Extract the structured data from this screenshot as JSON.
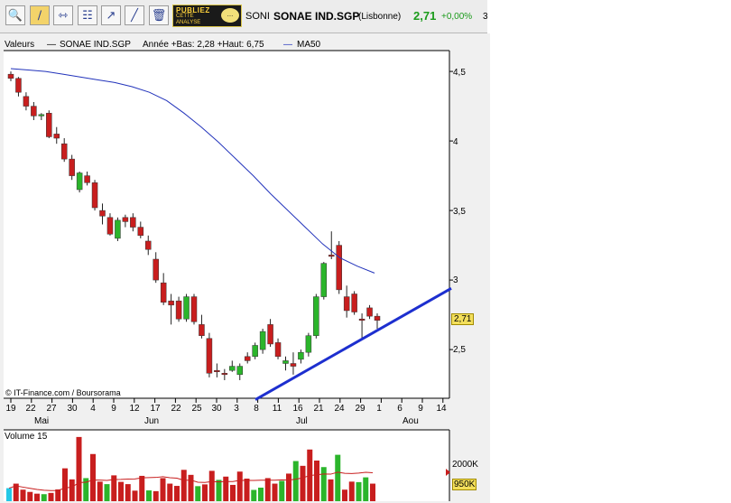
{
  "toolbar": {
    "buttons": [
      "zoom-icon",
      "draw-line-icon",
      "horizontal-line-icon",
      "indicators-icon",
      "fibonacci-icon",
      "trend-tool-icon",
      "trash-icon"
    ],
    "publiez_line1": "PUBLIEZ",
    "publiez_line2": "CETTE",
    "publiez_line3": "ANALYSE",
    "ticker_short": "SONI",
    "ticker": "SONAE IND.SGP",
    "market": "(Lisbonne)",
    "price": "2,71",
    "change": "+0,00%",
    "cut_digit": "3"
  },
  "legend": {
    "valeurs": "Valeurs",
    "series": "SONAE IND.SGP",
    "range": "Année +Bas: 2,28 +Haut: 6,75",
    "ma": "MA50"
  },
  "credit": "© IT-Finance.com / Boursorama",
  "volume_label": "Volume 15",
  "price_label": "2,71",
  "colors": {
    "up": "#2bb52b",
    "down": "#c81e1e",
    "ma": "#2233bb",
    "trend": "#1d2fcf",
    "volume_cyan": "#22c8e6",
    "price_tag": "#f3df5b"
  },
  "chart_data": [
    {
      "type": "candlestick",
      "title": "SONAE IND.SGP",
      "y_ticks": [
        "4,5",
        "4",
        "3,5",
        "3",
        "2,5"
      ],
      "y_tick_values": [
        4.5,
        4.0,
        3.5,
        3.0,
        2.5
      ],
      "ylim": [
        2.15,
        4.65
      ],
      "x_tick_labels": [
        "19",
        "22",
        "27",
        "30",
        "4",
        "9",
        "12",
        "17",
        "22",
        "25",
        "30",
        "3",
        "8",
        "11",
        "16",
        "21",
        "24",
        "29",
        "1",
        "6",
        "9",
        "14"
      ],
      "month_labels": [
        "Mai",
        "Jun",
        "Jul",
        "Aou"
      ],
      "candles": [
        [
          4.48,
          4.5,
          4.43,
          4.45
        ],
        [
          4.45,
          4.46,
          4.32,
          4.35
        ],
        [
          4.32,
          4.35,
          4.22,
          4.25
        ],
        [
          4.25,
          4.28,
          4.15,
          4.18
        ],
        [
          4.18,
          4.2,
          4.15,
          4.19
        ],
        [
          4.2,
          4.22,
          4.02,
          4.03
        ],
        [
          4.05,
          4.1,
          3.98,
          4.02
        ],
        [
          3.98,
          4.02,
          3.85,
          3.87
        ],
        [
          3.87,
          3.9,
          3.72,
          3.75
        ],
        [
          3.65,
          3.78,
          3.63,
          3.77
        ],
        [
          3.75,
          3.78,
          3.68,
          3.7
        ],
        [
          3.7,
          3.72,
          3.5,
          3.52
        ],
        [
          3.5,
          3.55,
          3.4,
          3.46
        ],
        [
          3.45,
          3.48,
          3.32,
          3.33
        ],
        [
          3.3,
          3.45,
          3.28,
          3.43
        ],
        [
          3.45,
          3.47,
          3.38,
          3.42
        ],
        [
          3.45,
          3.48,
          3.35,
          3.38
        ],
        [
          3.38,
          3.42,
          3.3,
          3.32
        ],
        [
          3.28,
          3.32,
          3.18,
          3.22
        ],
        [
          3.15,
          3.2,
          2.98,
          3.0
        ],
        [
          2.98,
          3.05,
          2.82,
          2.84
        ],
        [
          2.85,
          2.9,
          2.68,
          2.82
        ],
        [
          2.85,
          2.88,
          2.7,
          2.72
        ],
        [
          2.72,
          2.9,
          2.7,
          2.88
        ],
        [
          2.88,
          2.9,
          2.68,
          2.7
        ],
        [
          2.68,
          2.75,
          2.58,
          2.6
        ],
        [
          2.58,
          2.62,
          2.3,
          2.33
        ],
        [
          2.35,
          2.4,
          2.3,
          2.34
        ],
        [
          2.33,
          2.36,
          2.28,
          2.32
        ],
        [
          2.35,
          2.42,
          2.34,
          2.38
        ],
        [
          2.32,
          2.4,
          2.28,
          2.38
        ],
        [
          2.45,
          2.48,
          2.4,
          2.42
        ],
        [
          2.45,
          2.55,
          2.43,
          2.53
        ],
        [
          2.5,
          2.65,
          2.47,
          2.63
        ],
        [
          2.68,
          2.72,
          2.52,
          2.54
        ],
        [
          2.55,
          2.58,
          2.43,
          2.45
        ],
        [
          2.4,
          2.45,
          2.35,
          2.42
        ],
        [
          2.4,
          2.48,
          2.32,
          2.38
        ],
        [
          2.43,
          2.5,
          2.4,
          2.48
        ],
        [
          2.48,
          2.62,
          2.45,
          2.6
        ],
        [
          2.6,
          2.9,
          2.58,
          2.88
        ],
        [
          2.88,
          3.13,
          2.86,
          3.12
        ],
        [
          3.18,
          3.35,
          3.15,
          3.17
        ],
        [
          3.25,
          3.28,
          2.9,
          2.93
        ],
        [
          2.88,
          2.96,
          2.73,
          2.78
        ],
        [
          2.9,
          2.92,
          2.75,
          2.77
        ],
        [
          2.72,
          2.76,
          2.58,
          2.71
        ],
        [
          2.8,
          2.82,
          2.72,
          2.74
        ],
        [
          2.74,
          2.76,
          2.65,
          2.71
        ]
      ],
      "ma50": [
        4.52,
        4.51,
        4.5,
        4.48,
        4.46,
        4.44,
        4.42,
        4.39,
        4.35,
        4.29,
        4.2,
        4.1,
        3.99,
        3.87,
        3.75,
        3.62,
        3.5,
        3.38,
        3.26,
        3.16,
        3.1,
        3.05
      ],
      "trendline": {
        "from": [
          2.11,
          "7 Jul"
        ],
        "to": [
          2.94,
          "16 Aou"
        ]
      },
      "last_price": 2.71
    },
    {
      "type": "bar",
      "title": "Volume 15",
      "y_ticks": [
        "2000K",
        "950K"
      ],
      "values": [
        520,
        700,
        460,
        370,
        300,
        280,
        330,
        470,
        1310,
        870,
        2560,
        920,
        1880,
        780,
        680,
        1030,
        770,
        680,
        420,
        1010,
        430,
        400,
        920,
        700,
        610,
        1250,
        1050,
        600,
        670,
        1210,
        850,
        980,
        650,
        1180,
        900,
        450,
        540,
        920,
        700,
        810,
        1100,
        1600,
        1410,
        2060,
        1620,
        1360,
        870,
        1850,
        460,
        780,
        760,
        950,
        700
      ],
      "colors": [
        "cyan",
        "red",
        "red",
        "red",
        "red",
        "green",
        "red",
        "red",
        "red",
        "red",
        "red",
        "green",
        "red",
        "red",
        "green",
        "red",
        "red",
        "red",
        "red",
        "red",
        "green",
        "red",
        "red",
        "red",
        "red",
        "red",
        "red",
        "green",
        "red",
        "red",
        "green",
        "red",
        "red",
        "red",
        "red",
        "green",
        "green",
        "red",
        "red",
        "green",
        "red",
        "green",
        "red",
        "red",
        "red",
        "green",
        "red",
        "green",
        "red",
        "red",
        "green",
        "green"
      ],
      "average_line": true
    }
  ]
}
